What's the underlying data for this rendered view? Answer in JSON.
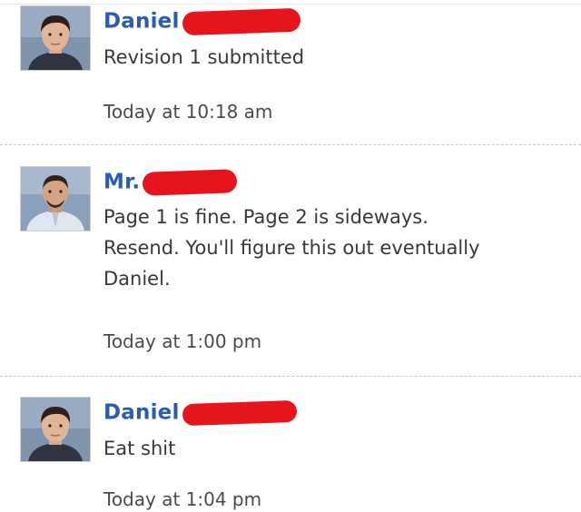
{
  "comments": [
    {
      "author": "Daniel",
      "avatar_icon": "student-avatar-icon",
      "text": "Revision 1 submitted",
      "time": "Today at 10:18 am"
    },
    {
      "author": "Mr.",
      "avatar_icon": "teacher-avatar-icon",
      "text_lines": [
        "Page 1 is fine. Page 2 is sideways.",
        "Resend. You'll figure this out eventually",
        "Daniel."
      ],
      "time": "Today at 1:00 pm"
    },
    {
      "author": "Daniel",
      "avatar_icon": "student-avatar-icon",
      "text": "Eat shit",
      "time": "Today at 1:04 pm"
    }
  ],
  "colors": {
    "author_link": "#2a5db0",
    "redaction": "#e8141d",
    "separator": "#c8c8c8"
  }
}
